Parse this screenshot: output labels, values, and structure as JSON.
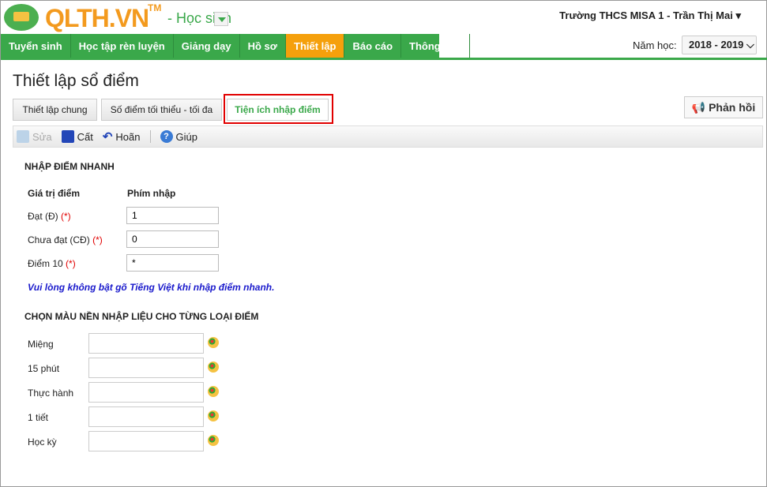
{
  "header": {
    "logo": "QLTH.VN",
    "tm": "TM",
    "role": "- Học sinh",
    "user": "Trường THCS MISA 1 - Trần Thị Mai ▾",
    "year_label": "Năm học:",
    "year_value": "2018 - 2019 ⌵"
  },
  "nav": [
    "Tuyển sinh",
    "Học tập rèn luyện",
    "Giảng dạy",
    "Hồ sơ",
    "Thiết lập",
    "Báo cáo",
    "Thông báo"
  ],
  "page_title": "Thiết lập sổ điểm",
  "tabs": [
    "Thiết lập chung",
    "Số điểm tối thiểu - tối đa",
    "Tiện ích nhập điểm"
  ],
  "feedback": "Phản hồi",
  "toolbar": {
    "edit": "Sửa",
    "save": "Cất",
    "undo": "Hoãn",
    "help": "Giúp"
  },
  "quick": {
    "title": "NHẬP ĐIỂM NHANH",
    "col1": "Giá trị điểm",
    "col2": "Phím nhập",
    "required": "(*)",
    "rows": [
      {
        "label": "Đạt (Đ)",
        "value": "1"
      },
      {
        "label": "Chưa đạt (CĐ)",
        "value": "0"
      },
      {
        "label": "Điểm 10",
        "value": "*"
      }
    ],
    "note": "Vui lòng không bật gõ Tiếng Việt khi nhập điểm nhanh."
  },
  "colors": {
    "title": "CHỌN MÀU NỀN NHẬP LIỆU CHO TỪNG LOẠI ĐIỂM",
    "rows": [
      "Miệng",
      "15 phút",
      "Thực hành",
      "1 tiết",
      "Học kỳ"
    ]
  }
}
